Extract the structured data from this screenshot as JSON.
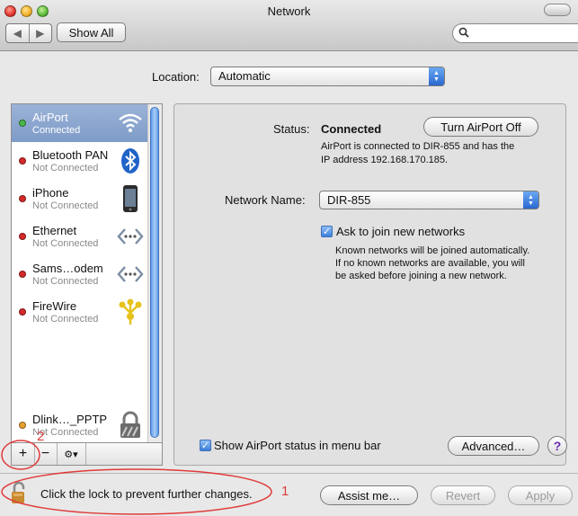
{
  "window": {
    "title": "Network"
  },
  "toolbar": {
    "back": "◀",
    "forward": "▶",
    "show_all": "Show All",
    "search_placeholder": ""
  },
  "location": {
    "label": "Location:",
    "value": "Automatic"
  },
  "services": [
    {
      "name": "AirPort",
      "status": "Connected",
      "dot": "#4ab84a",
      "icon": "wifi-icon"
    },
    {
      "name": "Bluetooth PAN",
      "status": "Not Connected",
      "dot": "#d42a2a",
      "icon": "bluetooth-icon"
    },
    {
      "name": "iPhone",
      "status": "Not Connected",
      "dot": "#d42a2a",
      "icon": "iphone-icon"
    },
    {
      "name": "Ethernet",
      "status": "Not Connected",
      "dot": "#d42a2a",
      "icon": "ethernet-icon"
    },
    {
      "name": "Sams…odem",
      "status": "Not Connected",
      "dot": "#d42a2a",
      "icon": "modem-icon"
    },
    {
      "name": "FireWire",
      "status": "Not Connected",
      "dot": "#d42a2a",
      "icon": "firewire-icon"
    },
    {
      "name": "Dlink…_PPTP",
      "status": "Not Connected",
      "dot": "#e8a030",
      "icon": "vpn-lock-icon"
    }
  ],
  "list_controls": {
    "add": "+",
    "remove": "−",
    "action": "⚙▾"
  },
  "detail": {
    "status_label": "Status:",
    "status_value": "Connected",
    "turn_off_button": "Turn AirPort Off",
    "status_desc_1": "AirPort is connected to DIR-855 and has the",
    "status_desc_2": "IP address 192.168.170.185.",
    "network_name_label": "Network Name:",
    "network_name_value": "DIR-855",
    "ask_join_label": "Ask to join new networks",
    "ask_join_checked": true,
    "ask_desc_1": "Known networks will be joined automatically.",
    "ask_desc_2": "If no known networks are available, you will",
    "ask_desc_3": "be asked before joining a new network.",
    "show_status_label": "Show AirPort status in menu bar",
    "show_status_checked": true,
    "advanced_button": "Advanced…",
    "help": "?"
  },
  "footer": {
    "lock_text": "Click the lock to prevent further changes.",
    "assist_button": "Assist me…",
    "revert_button": "Revert",
    "apply_button": "Apply"
  },
  "annotations": {
    "one": "1",
    "two": "2"
  },
  "colors": {
    "annotation": "#e03a3a",
    "selection": "#8aa6cf",
    "accent": "#2a68d0"
  }
}
